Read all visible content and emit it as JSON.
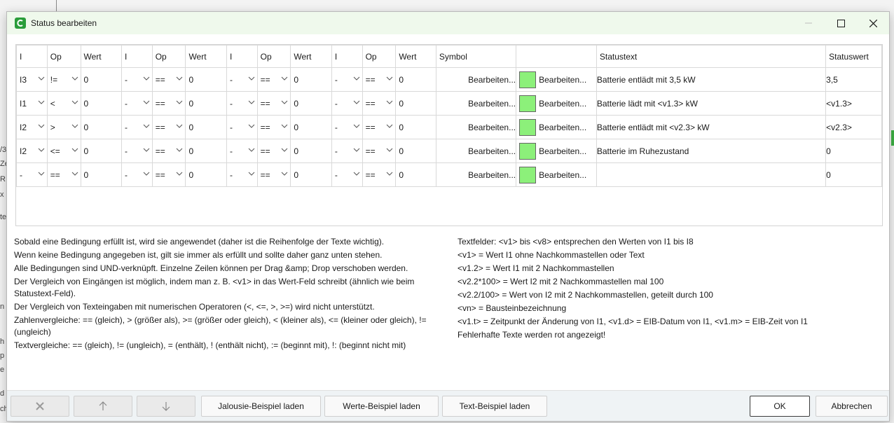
{
  "window": {
    "title": "Status bearbeiten",
    "controls": [
      "minimize-icon",
      "maximize-icon",
      "close-icon"
    ]
  },
  "table": {
    "headers": [
      "I",
      "Op",
      "Wert",
      "I",
      "Op",
      "Wert",
      "I",
      "Op",
      "Wert",
      "I",
      "Op",
      "Wert",
      "Symbol",
      "",
      "Statustext",
      "Statuswert"
    ],
    "rows": [
      {
        "conds": [
          [
            "I3",
            "!=",
            "0"
          ],
          [
            "-",
            "==",
            "0"
          ],
          [
            "-",
            "==",
            "0"
          ],
          [
            "-",
            "==",
            "0"
          ]
        ],
        "symbol": "Bearbeiten...",
        "color": "#8cf07a",
        "color_btn": "Bearbeiten...",
        "statustext": "Batterie entlädt mit 3,5 kW",
        "statuswert": "3,5"
      },
      {
        "conds": [
          [
            "I1",
            "<",
            "0"
          ],
          [
            "-",
            "==",
            "0"
          ],
          [
            "-",
            "==",
            "0"
          ],
          [
            "-",
            "==",
            "0"
          ]
        ],
        "symbol": "Bearbeiten...",
        "color": "#8cf07a",
        "color_btn": "Bearbeiten...",
        "statustext": "Batterie lädt mit <v1.3> kW",
        "statuswert": "<v1.3>"
      },
      {
        "conds": [
          [
            "I2",
            ">",
            "0"
          ],
          [
            "-",
            "==",
            "0"
          ],
          [
            "-",
            "==",
            "0"
          ],
          [
            "-",
            "==",
            "0"
          ]
        ],
        "symbol": "Bearbeiten...",
        "color": "#8cf07a",
        "color_btn": "Bearbeiten...",
        "statustext": "Batterie entlädt mit <v2.3> kW",
        "statuswert": "<v2.3>"
      },
      {
        "conds": [
          [
            "I2",
            "<=",
            "0"
          ],
          [
            "-",
            "==",
            "0"
          ],
          [
            "-",
            "==",
            "0"
          ],
          [
            "-",
            "==",
            "0"
          ]
        ],
        "symbol": "Bearbeiten...",
        "color": "#8cf07a",
        "color_btn": "Bearbeiten...",
        "statustext": "Batterie im Ruhezustand",
        "statuswert": "0"
      },
      {
        "conds": [
          [
            "-",
            "==",
            "0"
          ],
          [
            "-",
            "==",
            "0"
          ],
          [
            "-",
            "==",
            "0"
          ],
          [
            "-",
            "==",
            "0"
          ]
        ],
        "symbol": "Bearbeiten...",
        "color": "#8cf07a",
        "color_btn": "Bearbeiten...",
        "statustext": "",
        "statuswert": "0"
      }
    ]
  },
  "help_left": [
    "Sobald eine Bedingung erfüllt ist, wird sie angewendet (daher ist die Reihenfolge der Texte wichtig).",
    "Wenn keine Bedingung angegeben ist, gilt sie immer als erfüllt und sollte daher ganz unten stehen.",
    "Alle Bedingungen sind UND-verknüpft. Einzelne Zeilen können per Drag &amp; Drop verschoben werden.",
    "Der Vergleich von Eingängen ist möglich, indem man z. B. <v1> in das Wert-Feld schreibt (ähnlich wie beim Statustext-Feld).",
    "Der Vergleich von Texteingaben mit numerischen Operatoren (<, <=, >, >=) wird nicht unterstützt.",
    "Zahlenvergleiche: == (gleich), > (größer als), >= (größer oder gleich), < (kleiner als), <= (kleiner oder gleich), != (ungleich)",
    "Textvergleiche: == (gleich), != (ungleich), = (enthält), ! (enthält nicht), := (beginnt mit), !: (beginnt nicht mit)"
  ],
  "help_right": [
    "Textfelder: <v1> bis <v8> entsprechen den Werten von I1 bis I8",
    "<v1> = Wert I1 ohne Nachkommastellen oder Text",
    "<v1.2> = Wert I1 mit 2 Nachkommastellen",
    "<v2.2*100> = Wert I2 mit 2 Nachkommastellen mal 100",
    "<v2.2/100> = Wert von I2 mit 2 Nachkommastellen, geteilt durch 100",
    "<vn> = Bausteinbezeichnung",
    "<v1.t> = Zeitpunkt der Änderung von I1, <v1.d> = EIB-Datum von I1, <v1.m> = EIB-Zeit von I1",
    "Fehlerhafte Texte werden rot angezeigt!"
  ],
  "bottom": {
    "delete_icon": "close-x-icon",
    "up_icon": "arrow-up-icon",
    "down_icon": "arrow-down-icon",
    "jalousie": "Jalousie-Beispiel laden",
    "werte": "Werte-Beispiel laden",
    "text": "Text-Beispiel laden",
    "ok": "OK",
    "cancel": "Abbrechen"
  },
  "background": {
    "fragments": [
      "/3",
      "Ze",
      "R",
      "x",
      "te",
      "n",
      "h",
      "p",
      "e",
      "d",
      "ch"
    ],
    "accent": "#3cb043"
  }
}
